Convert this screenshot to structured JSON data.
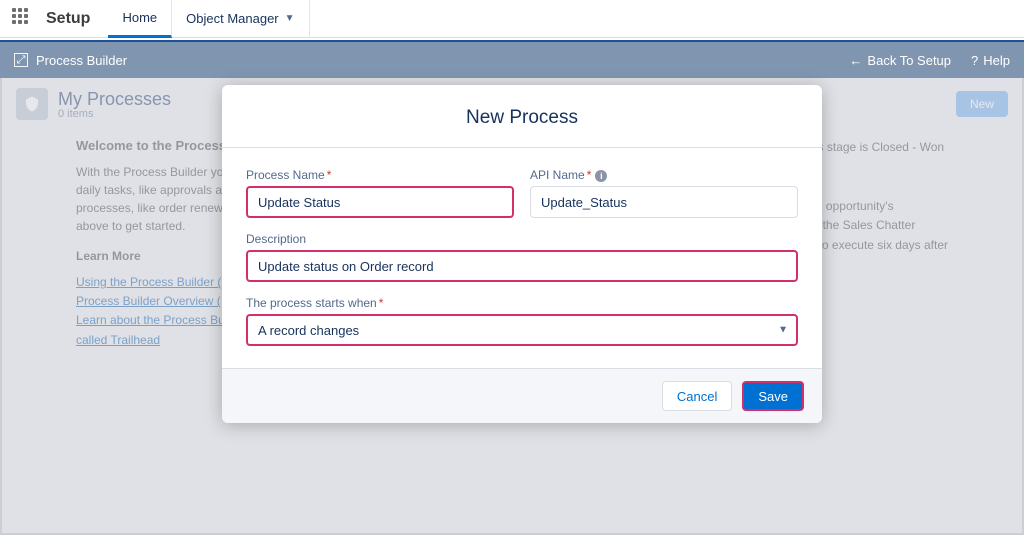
{
  "topnav": {
    "setup": "Setup",
    "tabs": [
      {
        "label": "Home",
        "active": true
      },
      {
        "label": "Object Manager",
        "active": false
      }
    ]
  },
  "subheader": {
    "title": "Process Builder",
    "back": "Back To Setup",
    "help": "Help"
  },
  "page": {
    "title": "My Processes",
    "subtitle": "0 items",
    "new_btn": "New",
    "welcome_heading": "Welcome to the Process Builder",
    "welcome_body": "With the Process Builder you daily tasks, like approvals and processes, like order renewals above to get started.",
    "learn_more": "Learn More",
    "links": [
      "Using the Process Builder (",
      "Process Builder Overview (",
      "Learn about the Process Bu",
      "called Trailhead"
    ],
    "right1": "unity's stage is Closed - Won",
    "right2": "ith the opportunity's",
    "right3": "ing to the Sales Chatter",
    "right4": "luled to execute six days after"
  },
  "modal": {
    "title": "New Process",
    "process_name_label": "Process Name",
    "process_name_value": "Update Status",
    "api_name_label": "API Name",
    "api_name_value": "Update_Status",
    "description_label": "Description",
    "description_value": "Update status on Order record",
    "starts_when_label": "The process starts when",
    "starts_when_value": "A record changes",
    "cancel": "Cancel",
    "save": "Save"
  }
}
